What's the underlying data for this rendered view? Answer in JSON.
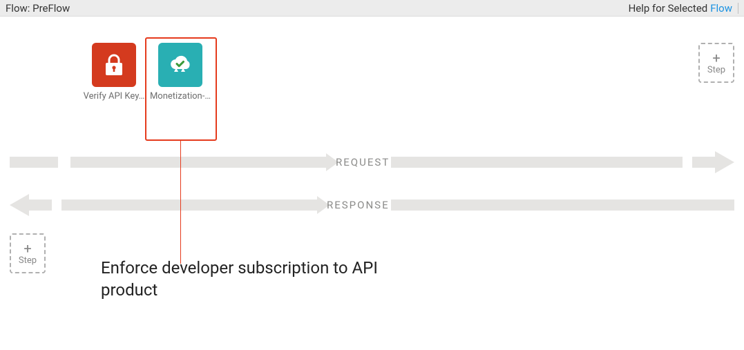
{
  "topbar": {
    "flow_label": "Flow: PreFlow",
    "help_label": "Help for Selected",
    "help_link_text": "Flow"
  },
  "policies": {
    "verify_api_key": {
      "label": "Verify API Key…"
    },
    "monetization": {
      "label": "Monetization-…"
    }
  },
  "bands": {
    "request": "REQUEST",
    "response": "RESPONSE"
  },
  "add_step": {
    "plus": "+",
    "label": "Step"
  },
  "callout": "Enforce developer subscription to API product"
}
